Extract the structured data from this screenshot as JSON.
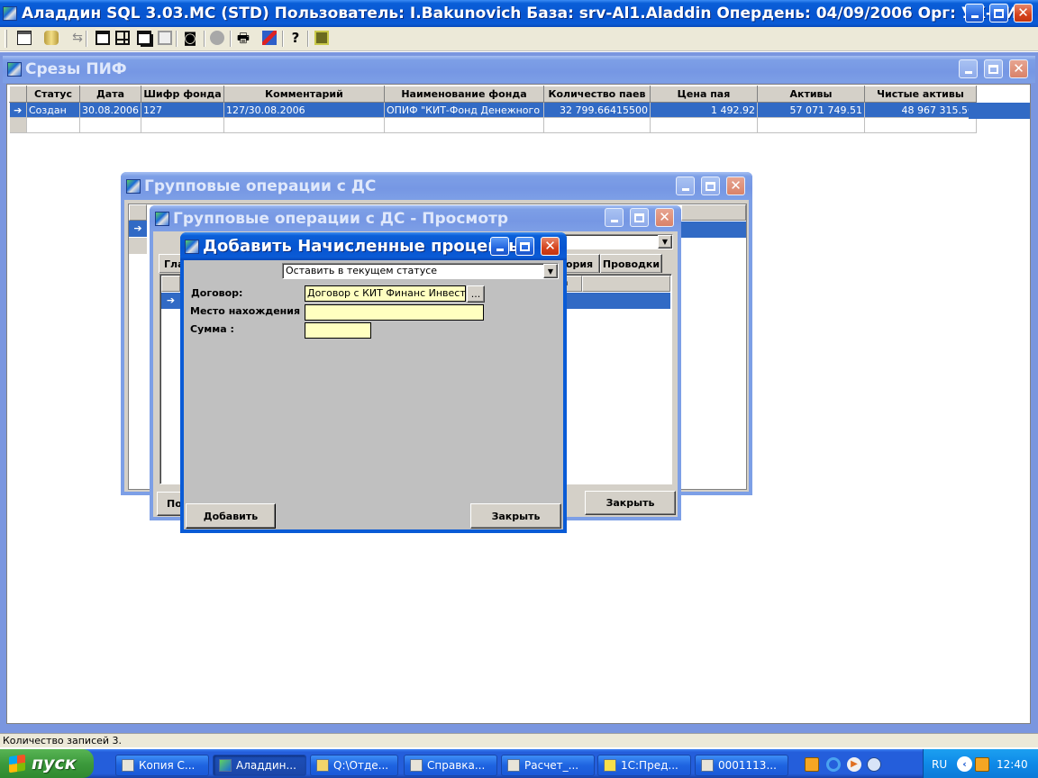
{
  "app": {
    "title": "Аладдин SQL 3.03.MC (STD)  Пользователь: I.Bakunovich База: srv-Al1.Aladdin Опердень: 04/09/2006 Орг: УК-КИТ"
  },
  "toolbar": {
    "icons": [
      "list-icon",
      "database-icon",
      "transfer-icon",
      "window-icon",
      "tile-icon",
      "cascade-icon",
      "minimize-all-icon",
      "binoculars-icon",
      "stop-icon",
      "printer-icon",
      "flag-icon",
      "help-icon",
      "exit-icon"
    ]
  },
  "srezy": {
    "title": "Срезы ПИФ",
    "columns": [
      "Статус",
      "Дата",
      "Шифр фонда",
      "Комментарий",
      "Наименование фонда",
      "Количество паев",
      "Цена пая",
      "Активы",
      "Чистые активы"
    ],
    "rows": [
      {
        "status": "Создан",
        "date": "30.08.2006",
        "code": "127",
        "comment": "127/30.08.2006",
        "name": "ОПИФ \"КИТ-Фонд Денежного ры",
        "shares": "32 799.66415500",
        "price": "1 492.92",
        "assets": "57 071 749.51",
        "net": "48 967 315.56"
      }
    ]
  },
  "group_ops": {
    "title": "Групповые операции с ДС"
  },
  "group_view": {
    "title": "Групповые операции с ДС - Просмотр",
    "tabs": [
      "Гла",
      "ория",
      "Проводки"
    ],
    "col_fragment": "а",
    "btn_left": "По",
    "btn_close": "Закрыть"
  },
  "dialog": {
    "title": "Добавить Начисленные проценты",
    "status_select": "Оставить в текущем статусе",
    "contract_label": "Договор:",
    "contract_value": "Договор с КИТ Финанс Инвестиц",
    "browse_label": "...",
    "location_label": "Место нахождения :",
    "location_value": "",
    "sum_label": "Сумма :",
    "sum_value": "",
    "add_button": "Добавить",
    "close_button": "Закрыть"
  },
  "status_bar": {
    "records": "Количество записей 3."
  },
  "taskbar": {
    "start": "пуск",
    "tasks": [
      "Копия С...",
      "Аладдин...",
      "Q:\\Отде...",
      "Справка...",
      "Расчет_...",
      "1С:Пред...",
      "0001113..."
    ],
    "lang": "RU",
    "clock": "12:40"
  },
  "colors": {
    "xp_blue": "#0a5fd8",
    "selection": "#316ac5",
    "input_yellow": "#ffffc0",
    "taskbar": "#245edb",
    "start_green": "#3c9a3c"
  }
}
